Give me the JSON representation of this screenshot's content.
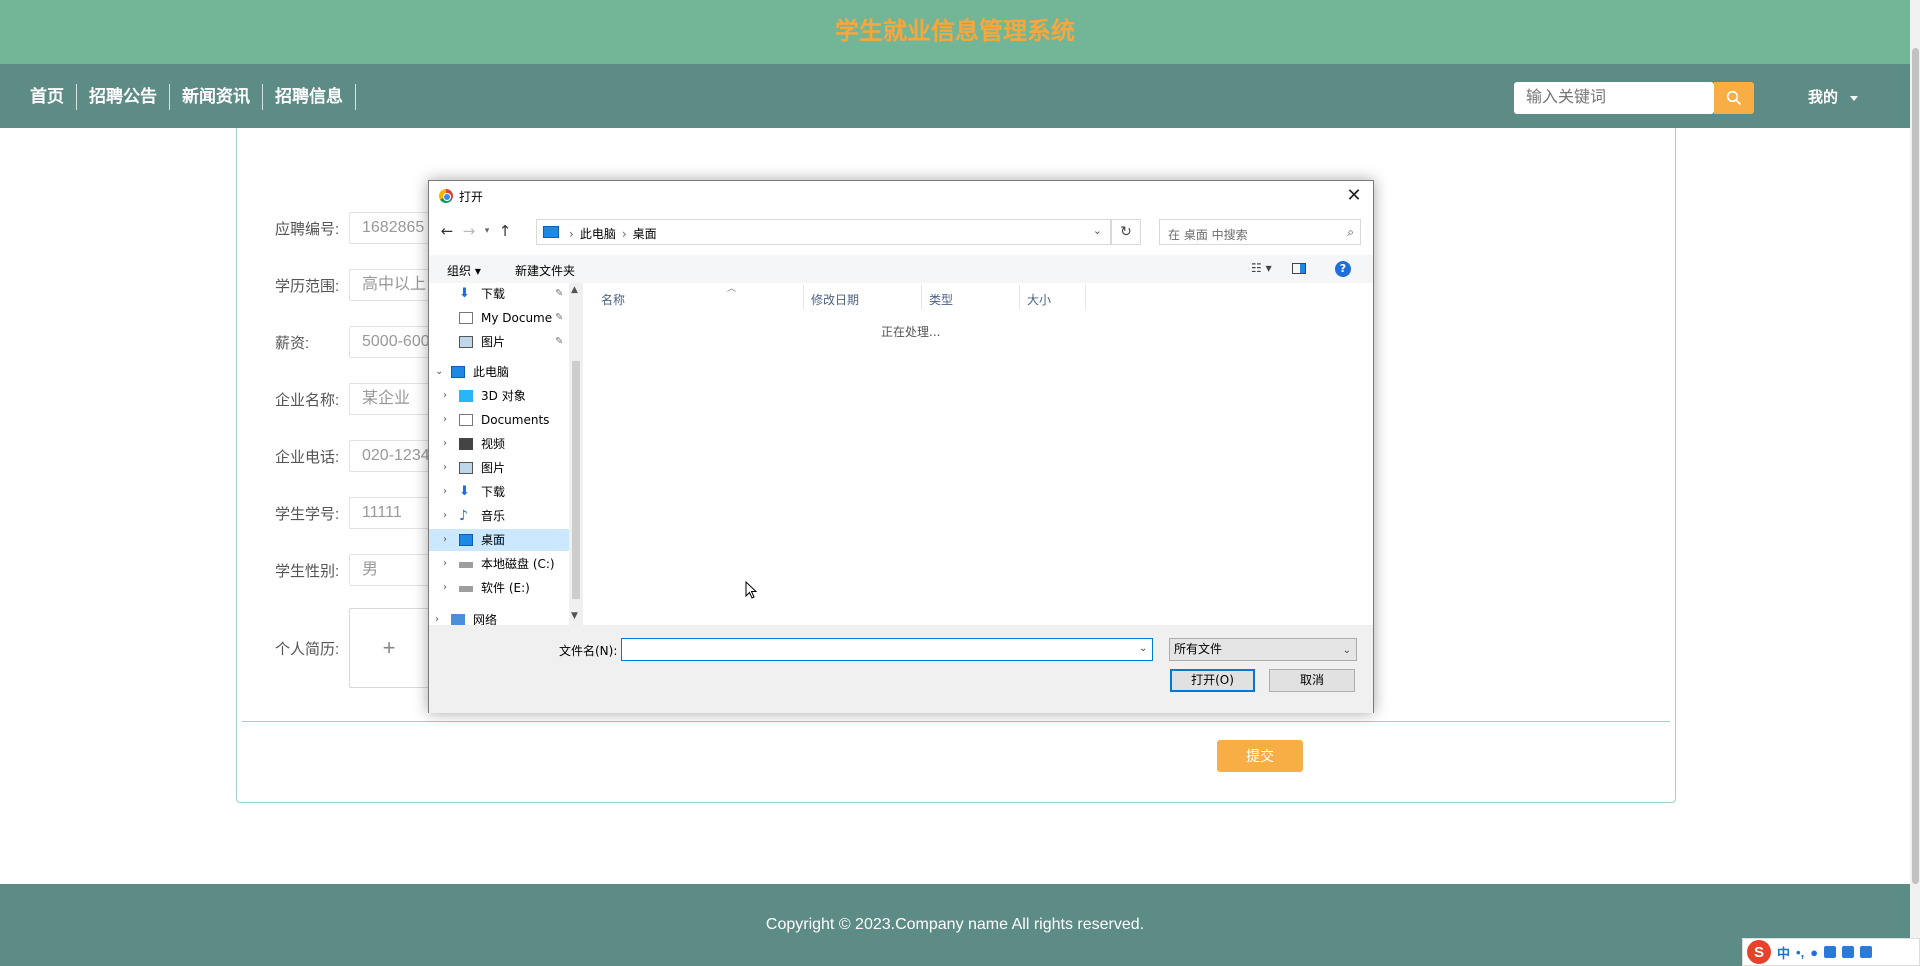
{
  "site": {
    "title": "学生就业信息管理系统",
    "nav": [
      "首页",
      "招聘公告",
      "新闻资讯",
      "招聘信息"
    ],
    "search_placeholder": "输入关键词",
    "user_menu": "我的"
  },
  "form": {
    "fields": [
      {
        "label": "应聘编号:",
        "value": "1682865"
      },
      {
        "label": "学历范围:",
        "value": "高中以上"
      },
      {
        "label": "薪资:",
        "value": "5000-600"
      },
      {
        "label": "企业名称:",
        "value": "某企业"
      },
      {
        "label": "企业电话:",
        "value": "020-1234"
      },
      {
        "label": "学生学号:",
        "value": "11111"
      },
      {
        "label": "学生性别:",
        "value": "男"
      }
    ],
    "resume_label": "个人简历:",
    "upload_plus": "+",
    "submit": "提交"
  },
  "footer": {
    "copyright": "Copyright © 2023.Company name All rights reserved."
  },
  "ime": {
    "logo": "S",
    "mode": "中",
    "punct": "•,"
  },
  "dialog": {
    "title": "打开",
    "close": "✕",
    "breadcrumb": [
      "此电脑",
      "桌面"
    ],
    "search_placeholder": "在 桌面 中搜索",
    "toolbar": {
      "organize": "组织 ▾",
      "new_folder": "新建文件夹",
      "help": "?"
    },
    "tree": [
      {
        "label": "下载",
        "pinned": true
      },
      {
        "label": "My Docume",
        "pinned": true
      },
      {
        "label": "图片",
        "pinned": true
      },
      {
        "label": "此电脑",
        "expanded": true
      },
      {
        "label": "3D 对象"
      },
      {
        "label": "Documents"
      },
      {
        "label": "视频"
      },
      {
        "label": "图片"
      },
      {
        "label": "下载"
      },
      {
        "label": "音乐"
      },
      {
        "label": "桌面",
        "selected": true
      },
      {
        "label": "本地磁盘 (C:)"
      },
      {
        "label": "软件 (E:)"
      },
      {
        "label": "网络"
      }
    ],
    "columns": [
      "名称",
      "修改日期",
      "类型",
      "大小"
    ],
    "status": "正在处理...",
    "filename_label": "文件名(N):",
    "filename_value": "",
    "filetype": "所有文件",
    "open_button": "打开(O)",
    "cancel_button": "取消"
  }
}
